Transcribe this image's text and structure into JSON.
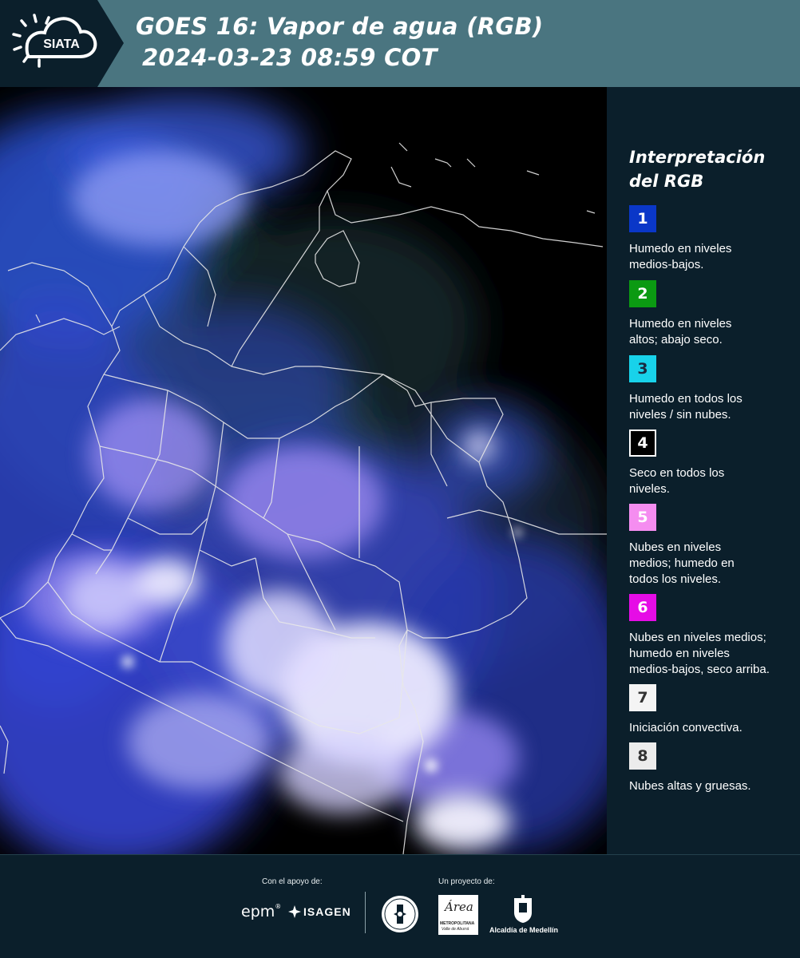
{
  "header": {
    "logo_text": "SIATA",
    "title_line1": "GOES 16: Vapor de agua (RGB)",
    "title_line2": "2024-03-23 08:59 COT"
  },
  "legend": {
    "title_line1": "Interpretación",
    "title_line2": "del RGB",
    "items": [
      {
        "number": "1",
        "color": "#0a37c8",
        "text_color": "#ffffff",
        "lines": [
          "Humedo en niveles",
          "medios-bajos."
        ]
      },
      {
        "number": "2",
        "color": "#0b9a12",
        "text_color": "#ffffff",
        "lines": [
          "Humedo en niveles",
          "altos; abajo seco."
        ]
      },
      {
        "number": "3",
        "color": "#18d2ea",
        "text_color": "#1a2a40",
        "lines": [
          "Humedo en todos los",
          "niveles / sin nubes."
        ]
      },
      {
        "number": "4",
        "color": "#000000",
        "text_color": "#ffffff",
        "lines": [
          "Seco en todos los",
          "niveles."
        ]
      },
      {
        "number": "5",
        "color": "#f58df0",
        "text_color": "#ffffff",
        "lines": [
          "Nubes en niveles",
          "medios; humedo en",
          "todos los niveles."
        ]
      },
      {
        "number": "6",
        "color": "#e60ce6",
        "text_color": "#ffffff",
        "lines": [
          "Nubes en niveles medios;",
          "humedo en niveles",
          "medios-bajos, seco arriba."
        ]
      },
      {
        "number": "7",
        "color": "#f4f4f4",
        "text_color": "#333333",
        "lines": [
          "Iniciación convectiva."
        ]
      },
      {
        "number": "8",
        "color": "#ececec",
        "text_color": "#333333",
        "lines": [
          "Nubes altas y gruesas."
        ]
      }
    ]
  },
  "footer": {
    "support_label": "Con el apoyo de:",
    "project_label": "Un proyecto de:",
    "epm": "epm",
    "isagen": "ISAGEN",
    "area_name": "Área",
    "area_sub1": "METROPOLITANA",
    "area_sub2": "Valle de Aburrá",
    "alcaldia": "Alcaldía de Medellín"
  }
}
